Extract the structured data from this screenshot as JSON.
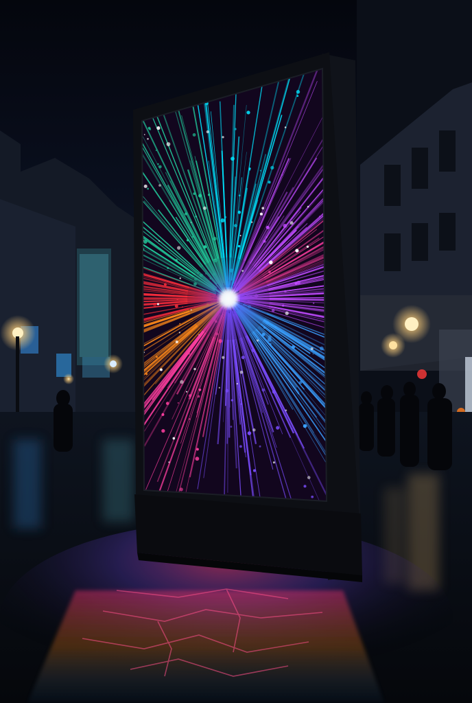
{
  "scene": {
    "subject": "digital-signage-kiosk",
    "setting": "night-city-street",
    "weather": "wet-pavement",
    "sky_color": "#060a14",
    "street_color": "#0a0d14"
  },
  "display": {
    "content": "radial-light-burst",
    "burst_colors": [
      "#22d3a0",
      "#3aa0ff",
      "#7b4dff",
      "#c04bff",
      "#ff3fa0",
      "#ff2e3c",
      "#ff8a1a",
      "#ffd23a",
      "#00e5ff",
      "#ffffff"
    ]
  },
  "kiosk": {
    "frame_color": "#0d0f14",
    "base_color": "#0a0b0f"
  },
  "street_lights": {
    "color": "#ffcf7a"
  }
}
